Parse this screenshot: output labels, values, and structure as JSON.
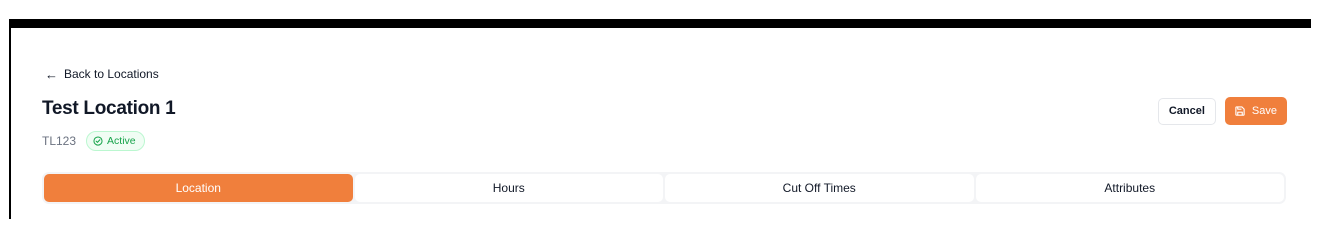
{
  "back_link": {
    "label": "Back to Locations",
    "icon": "arrow-left-icon"
  },
  "location": {
    "title": "Test Location 1",
    "code": "TL123",
    "status": "Active",
    "status_icon": "check-circle-icon",
    "status_color": "#16a34a"
  },
  "actions": {
    "cancel_label": "Cancel",
    "save_label": "Save",
    "save_icon": "save-icon",
    "accent_color": "#f07f3c"
  },
  "tabs": [
    {
      "label": "Location",
      "active": true
    },
    {
      "label": "Hours",
      "active": false
    },
    {
      "label": "Cut Off Times",
      "active": false
    },
    {
      "label": "Attributes",
      "active": false
    }
  ]
}
